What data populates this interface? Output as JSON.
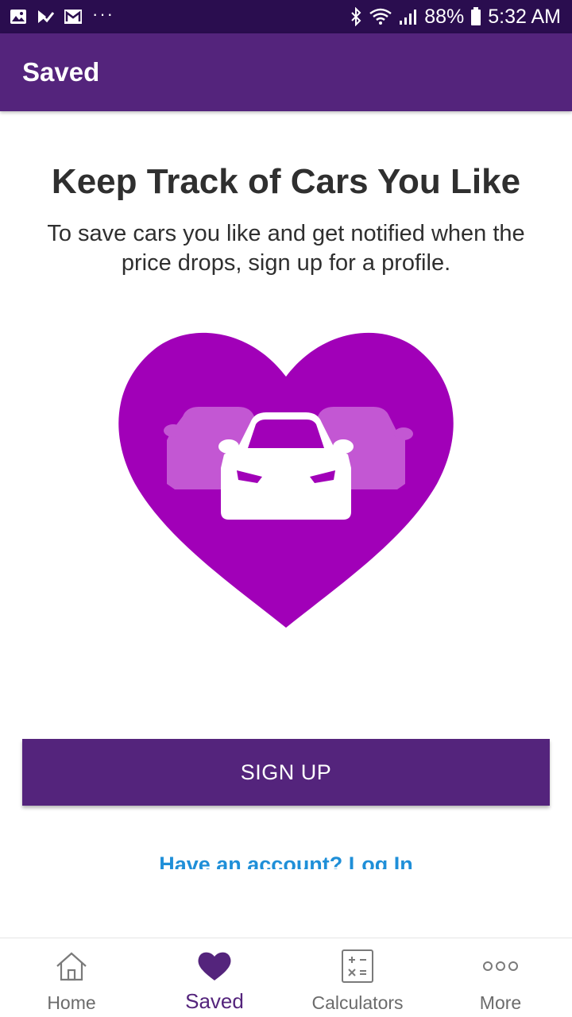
{
  "status_bar": {
    "battery": "88%",
    "time": "5:32 AM",
    "icons": [
      "image-icon",
      "task-check-icon",
      "gmail-icon",
      "more-dots-icon",
      "bluetooth-icon",
      "wifi-icon",
      "signal-icon",
      "battery-icon"
    ]
  },
  "app_bar": {
    "title": "Saved"
  },
  "main": {
    "heading": "Keep Track of Cars You Like",
    "subtext": "To save cars you like and get notified when the price drops, sign up for a profile.",
    "illustration": "heart-with-cars-icon",
    "signup_label": "SIGN UP",
    "login_link": "Have an account? Log In"
  },
  "bottom_nav": {
    "items": [
      {
        "label": "Home",
        "icon": "home-icon",
        "active": false
      },
      {
        "label": "Saved",
        "icon": "heart-icon",
        "active": true
      },
      {
        "label": "Calculators",
        "icon": "calculator-icon",
        "active": false
      },
      {
        "label": "More",
        "icon": "more-circles-icon",
        "active": false
      }
    ]
  },
  "colors": {
    "status_bar": "#2a0d4f",
    "primary": "#54247c",
    "heart": "#a100b8",
    "link": "#1f8fd8",
    "text": "#2f2f2f"
  }
}
